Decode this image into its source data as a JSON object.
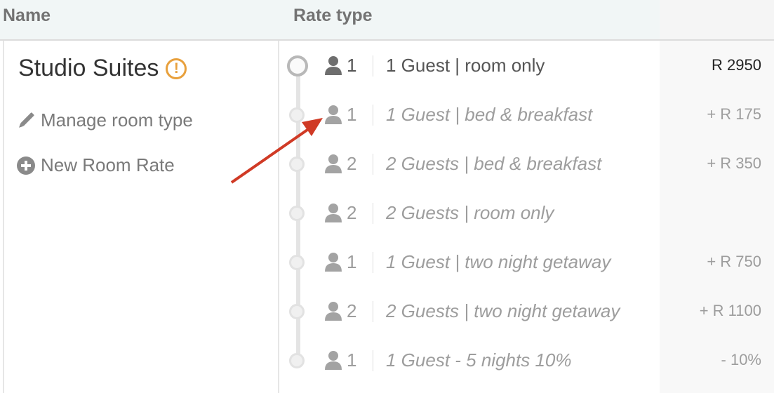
{
  "header": {
    "name_label": "Name",
    "rate_type_label": "Rate type"
  },
  "room": {
    "title": "Studio Suites",
    "warning_icon": "exclamation-circle-icon",
    "warning_glyph": "!",
    "manage_label": "Manage room type",
    "new_rate_label": "New Room Rate"
  },
  "rates": [
    {
      "guests": "1",
      "name": "1 Guest | room only",
      "price": "R 2950",
      "active": true
    },
    {
      "guests": "1",
      "name": "1 Guest | bed & breakfast",
      "price": "+ R 175",
      "active": false
    },
    {
      "guests": "2",
      "name": "2 Guests | bed & breakfast",
      "price": "+ R 350",
      "active": false
    },
    {
      "guests": "2",
      "name": "2 Guests | room only",
      "price": "",
      "active": false
    },
    {
      "guests": "1",
      "name": "1 Guest | two night getaway",
      "price": "+ R 750",
      "active": false
    },
    {
      "guests": "2",
      "name": "2 Guests | two night getaway",
      "price": "+ R 1100",
      "active": false
    },
    {
      "guests": "1",
      "name": "1 Guest - 5 nights 10%",
      "price": "- 10%",
      "active": false
    }
  ],
  "colors": {
    "warning": "#e8a03c",
    "annotation_arrow": "#d03a25",
    "header_bg": "#f1f6f6"
  }
}
